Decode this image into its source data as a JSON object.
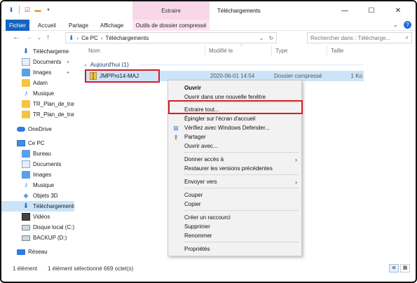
{
  "window": {
    "title": "Téléchargements",
    "contextual_tab_header": "Extraire",
    "controls": [
      "—",
      "☐",
      "✕"
    ]
  },
  "ribbon": {
    "tabs": [
      {
        "label": "Fichier"
      },
      {
        "label": "Accueil"
      },
      {
        "label": "Partage"
      },
      {
        "label": "Affichage"
      },
      {
        "label": "Outils de dossier compressé"
      }
    ]
  },
  "address": {
    "path": [
      "Ce PC",
      "Téléchargements"
    ],
    "search_placeholder": "Rechercher dans : Télécharge..."
  },
  "sidebar": {
    "quick_access": [
      {
        "label": "Téléchargeme",
        "icon": "download-icon",
        "pinned": true
      },
      {
        "label": "Documents",
        "icon": "document-icon",
        "pinned": true
      },
      {
        "label": "Images",
        "icon": "image-icon",
        "pinned": true
      },
      {
        "label": "Adam",
        "icon": "folder-icon",
        "pinned": false
      },
      {
        "label": "Musique",
        "icon": "music-icon",
        "pinned": false
      },
      {
        "label": "TR_Plan_de_trav",
        "icon": "folder-icon",
        "pinned": false
      },
      {
        "label": "TR_Plan_de_trav",
        "icon": "folder-icon",
        "pinned": false
      }
    ],
    "onedrive": "OneDrive",
    "this_pc": "Ce PC",
    "pc_items": [
      {
        "label": "Bureau",
        "icon": "desktop-icon"
      },
      {
        "label": "Documents",
        "icon": "document-icon"
      },
      {
        "label": "Images",
        "icon": "image-icon"
      },
      {
        "label": "Musique",
        "icon": "music-icon"
      },
      {
        "label": "Objets 3D",
        "icon": "3d-objects-icon"
      },
      {
        "label": "Téléchargements",
        "icon": "download-icon",
        "selected": true
      },
      {
        "label": "Vidéos",
        "icon": "video-icon"
      },
      {
        "label": "Disque local (C:)",
        "icon": "drive-icon"
      },
      {
        "label": "BACKUP (D:)",
        "icon": "drive-icon"
      }
    ],
    "network": "Réseau"
  },
  "columns": {
    "name": "Nom",
    "modified": "Modifié le",
    "type": "Type",
    "size": "Taille"
  },
  "group": {
    "label": "Aujourd'hui (1)"
  },
  "file": {
    "name": "JMPPro14-MAJ",
    "date": "2020-06-01 14:54",
    "type": "Dossier compressé",
    "size": "1 Ko"
  },
  "context_menu": {
    "items": [
      {
        "label": "Ouvrir",
        "bold": true
      },
      {
        "label": "Ouvrir dans une nouvelle fenêtre"
      },
      {
        "label": "Extraire tout..."
      },
      {
        "label": "Épingler sur l'écran d'accueil"
      },
      {
        "label": "Vérifiez avec Windows Defender...",
        "icon": "defender-icon"
      },
      {
        "label": "Partager",
        "icon": "share-icon"
      },
      {
        "label": "Ouvrir avec..."
      },
      {
        "label": "Donner accès à",
        "submenu": true
      },
      {
        "label": "Restaurer les versions précédentes"
      },
      {
        "label": "Envoyer vers",
        "submenu": true
      },
      {
        "label": "Couper"
      },
      {
        "label": "Copier"
      },
      {
        "label": "Créer un raccourci"
      },
      {
        "label": "Supprimer"
      },
      {
        "label": "Renommer"
      },
      {
        "label": "Propriétés"
      }
    ]
  },
  "status": {
    "count": "1 élément",
    "selection": "1 élément sélectionné  669 octet(s)"
  },
  "colors": {
    "accent": "#1565c0",
    "selection": "#cce4f7",
    "highlight": "#d61c24",
    "contextual_tab": "#f8d7e8"
  }
}
